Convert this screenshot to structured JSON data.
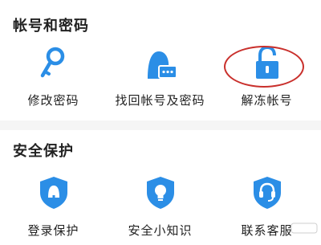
{
  "account_section": {
    "title": "帐号和密码",
    "items": [
      {
        "label": "修改密码",
        "icon": "key-icon"
      },
      {
        "label": "找回帐号及密码",
        "icon": "user-recovery-icon"
      },
      {
        "label": "解冻帐号",
        "icon": "unlock-icon"
      }
    ]
  },
  "security_section": {
    "title": "安全保护",
    "items": [
      {
        "label": "登录保护",
        "icon": "login-protect-shield-icon"
      },
      {
        "label": "安全小知识",
        "icon": "tips-bulb-shield-icon"
      },
      {
        "label": "联系客服",
        "icon": "customer-service-shield-icon"
      }
    ]
  },
  "colors": {
    "accent": "#2b8ee6",
    "highlight": "#c9302c"
  }
}
